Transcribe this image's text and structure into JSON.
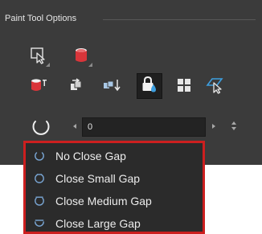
{
  "panel": {
    "title": "Paint Tool Options"
  },
  "tool_rows": {
    "row1": [
      {
        "icon": "select-tool-icon",
        "has_flyout": true
      },
      {
        "icon": "paint-bucket-icon",
        "has_flyout": true
      }
    ],
    "row2": [
      {
        "icon": "paint-mode-icon"
      },
      {
        "icon": "apply-to-multiple-drawings-icon"
      },
      {
        "icon": "apply-to-line-and-colour-icon"
      },
      {
        "icon": "respect-protected-colour-icon",
        "active": true
      },
      {
        "icon": "paint-mode-grid-icon"
      },
      {
        "icon": "tool-preset-icon"
      }
    ]
  },
  "close_gap": {
    "selected_icon": "no-close-gap-icon",
    "value": "0"
  },
  "dropdown": {
    "highlight_color": "#cc1f1f",
    "items": [
      {
        "label": "No Close Gap",
        "icon": "no-close-gap-icon"
      },
      {
        "label": "Close Small Gap",
        "icon": "close-small-gap-icon"
      },
      {
        "label": "Close Medium Gap",
        "icon": "close-medium-gap-icon"
      },
      {
        "label": "Close Large Gap",
        "icon": "close-large-gap-icon"
      }
    ]
  },
  "colors": {
    "panel_bg": "#3b3b3b",
    "field_bg": "#232323",
    "dropdown_bg": "#2b2b2b",
    "accent_blue": "#3d9fe0",
    "paint_red": "#d9353a"
  }
}
